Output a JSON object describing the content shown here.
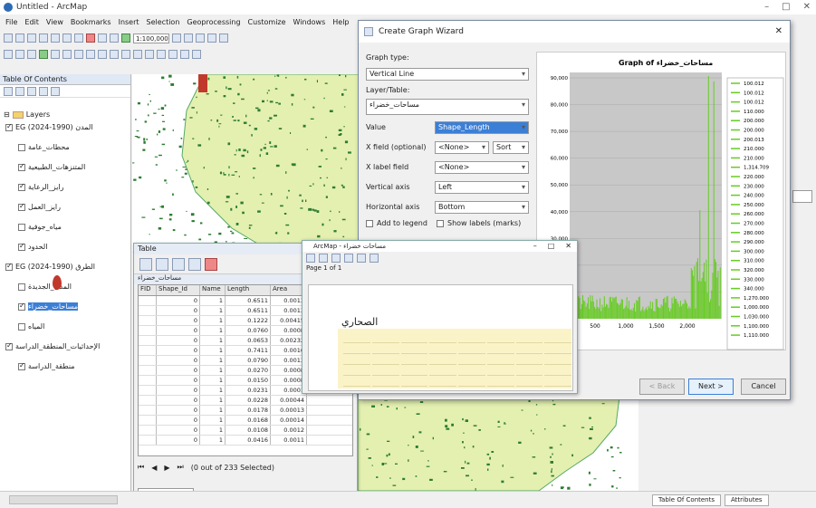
{
  "app": {
    "title": "Untitled - ArcMap"
  },
  "menu": [
    "File",
    "Edit",
    "View",
    "Bookmarks",
    "Insert",
    "Selection",
    "Geoprocessing",
    "Customize",
    "Windows",
    "Help"
  ],
  "toolbar": {
    "scale": "1:100,000"
  },
  "toc": {
    "title": "Table Of Contents",
    "layers_label": "Layers",
    "items": [
      {
        "label": "EG (2024-1990) المدن",
        "checked": true,
        "indent": 0
      },
      {
        "label": "محطات_عامة",
        "checked": false,
        "indent": 1
      },
      {
        "label": "المتنزهات_الطبيعية",
        "checked": true,
        "indent": 1
      },
      {
        "label": "رايز_الرعاية",
        "checked": true,
        "indent": 1
      },
      {
        "label": "رايز_العمل",
        "checked": true,
        "indent": 1
      },
      {
        "label": "مياه_جوفية",
        "checked": false,
        "indent": 1
      },
      {
        "label": "الحدود",
        "checked": true,
        "indent": 1
      },
      {
        "label": "EG (2024-1990) الطرق",
        "checked": true,
        "indent": 0
      },
      {
        "label": "المدن_الجديدة",
        "checked": false,
        "indent": 1
      },
      {
        "label": "مساحات_خضراء",
        "checked": true,
        "indent": 1,
        "selected": true
      },
      {
        "label": "المياه",
        "checked": false,
        "indent": 1
      },
      {
        "label": "الإحداثيات_المنطقة_الدراسة",
        "checked": true,
        "indent": 0
      },
      {
        "label": "منطقة_الدراسة",
        "checked": true,
        "indent": 1
      }
    ]
  },
  "table": {
    "title": "Table",
    "layer_tab": "مساحات_خضراء",
    "columns": [
      "FID",
      "Shape_Id",
      "Name",
      "Length",
      "Area"
    ],
    "rows": [
      [
        "",
        "0",
        "1",
        "0.6511",
        "0.0013"
      ],
      [
        "",
        "0",
        "1",
        "0.6511",
        "0.0013"
      ],
      [
        "",
        "0",
        "1",
        "0.1222",
        "0.00415"
      ],
      [
        "",
        "0",
        "1",
        "0.0760",
        "0.0008"
      ],
      [
        "",
        "0",
        "1",
        "0.0653",
        "0.00232"
      ],
      [
        "",
        "0",
        "1",
        "0.7411",
        "0.0016"
      ],
      [
        "",
        "0",
        "1",
        "0.0790",
        "0.0013"
      ],
      [
        "",
        "0",
        "1",
        "0.0270",
        "0.0008"
      ],
      [
        "",
        "0",
        "1",
        "0.0150",
        "0.0008"
      ],
      [
        "",
        "0",
        "1",
        "0.0231",
        "0.0001"
      ],
      [
        "",
        "0",
        "1",
        "0.0228",
        "0.00044"
      ],
      [
        "",
        "0",
        "1",
        "0.0178",
        "0.00013"
      ],
      [
        "",
        "0",
        "1",
        "0.0168",
        "0.00014"
      ],
      [
        "",
        "0",
        "1",
        "0.0108",
        "0.0012"
      ],
      [
        "",
        "0",
        "1",
        "0.0416",
        "0.0011"
      ]
    ],
    "selection_text": "(0 out of 233 Selected)"
  },
  "wizard": {
    "title": "Create Graph Wizard",
    "graph_type_label": "Graph type:",
    "graph_type_value": "Vertical Line",
    "layer_label": "Layer/Table:",
    "layer_value": "مساحات_خضراء",
    "value_field_label": "Value",
    "value_field_value": "Shape_Length",
    "xfield_label": "X field (optional)",
    "xfield_value": "<None>",
    "sort_label": "Sort",
    "xlabel_label": "X label field",
    "xlabel_value": "<None>",
    "vaxis_label": "Vertical axis",
    "vaxis_value": "Left",
    "haxis_label": "Horizontal axis",
    "haxis_value": "Bottom",
    "add_legend_label": "Add to legend",
    "show_labels_label": "Show labels (marks)",
    "buttons": {
      "back": "< Back",
      "next": "Next >",
      "cancel": "Cancel"
    }
  },
  "report": {
    "title": "ArcMap - مساحات خضراء",
    "heading": "الصحاري",
    "page_label": "Page 1 of 1"
  },
  "status": {
    "toc_tab": "Table Of Contents",
    "attributes_tab": "Attributes"
  },
  "chart_data": {
    "type": "bar",
    "title": "Graph of مساحات_خضراء",
    "xlabel": "",
    "ylabel": "",
    "y_ticks": [
      "10,000",
      "20,000",
      "30,000",
      "40,000",
      "50,000",
      "60,000",
      "70,000",
      "80,000",
      "90,000"
    ],
    "x_ticks": [
      "500",
      "1,000",
      "1,500",
      "2,000"
    ],
    "color": "#66cc22",
    "legend": [
      "100.012",
      "100.012",
      "100.012",
      "110.000",
      "200.000",
      "200.000",
      "200.013",
      "210.000",
      "210.000",
      "1,314.709",
      "220.000",
      "230.000",
      "240.000",
      "250.000",
      "260.000",
      "270.000",
      "280.000",
      "290.000",
      "300.000",
      "310.000",
      "320.000",
      "330.000",
      "340.000",
      "1,270.000",
      "1,000.000",
      "1,030.000",
      "1,100.000",
      "1,110.000"
    ]
  }
}
